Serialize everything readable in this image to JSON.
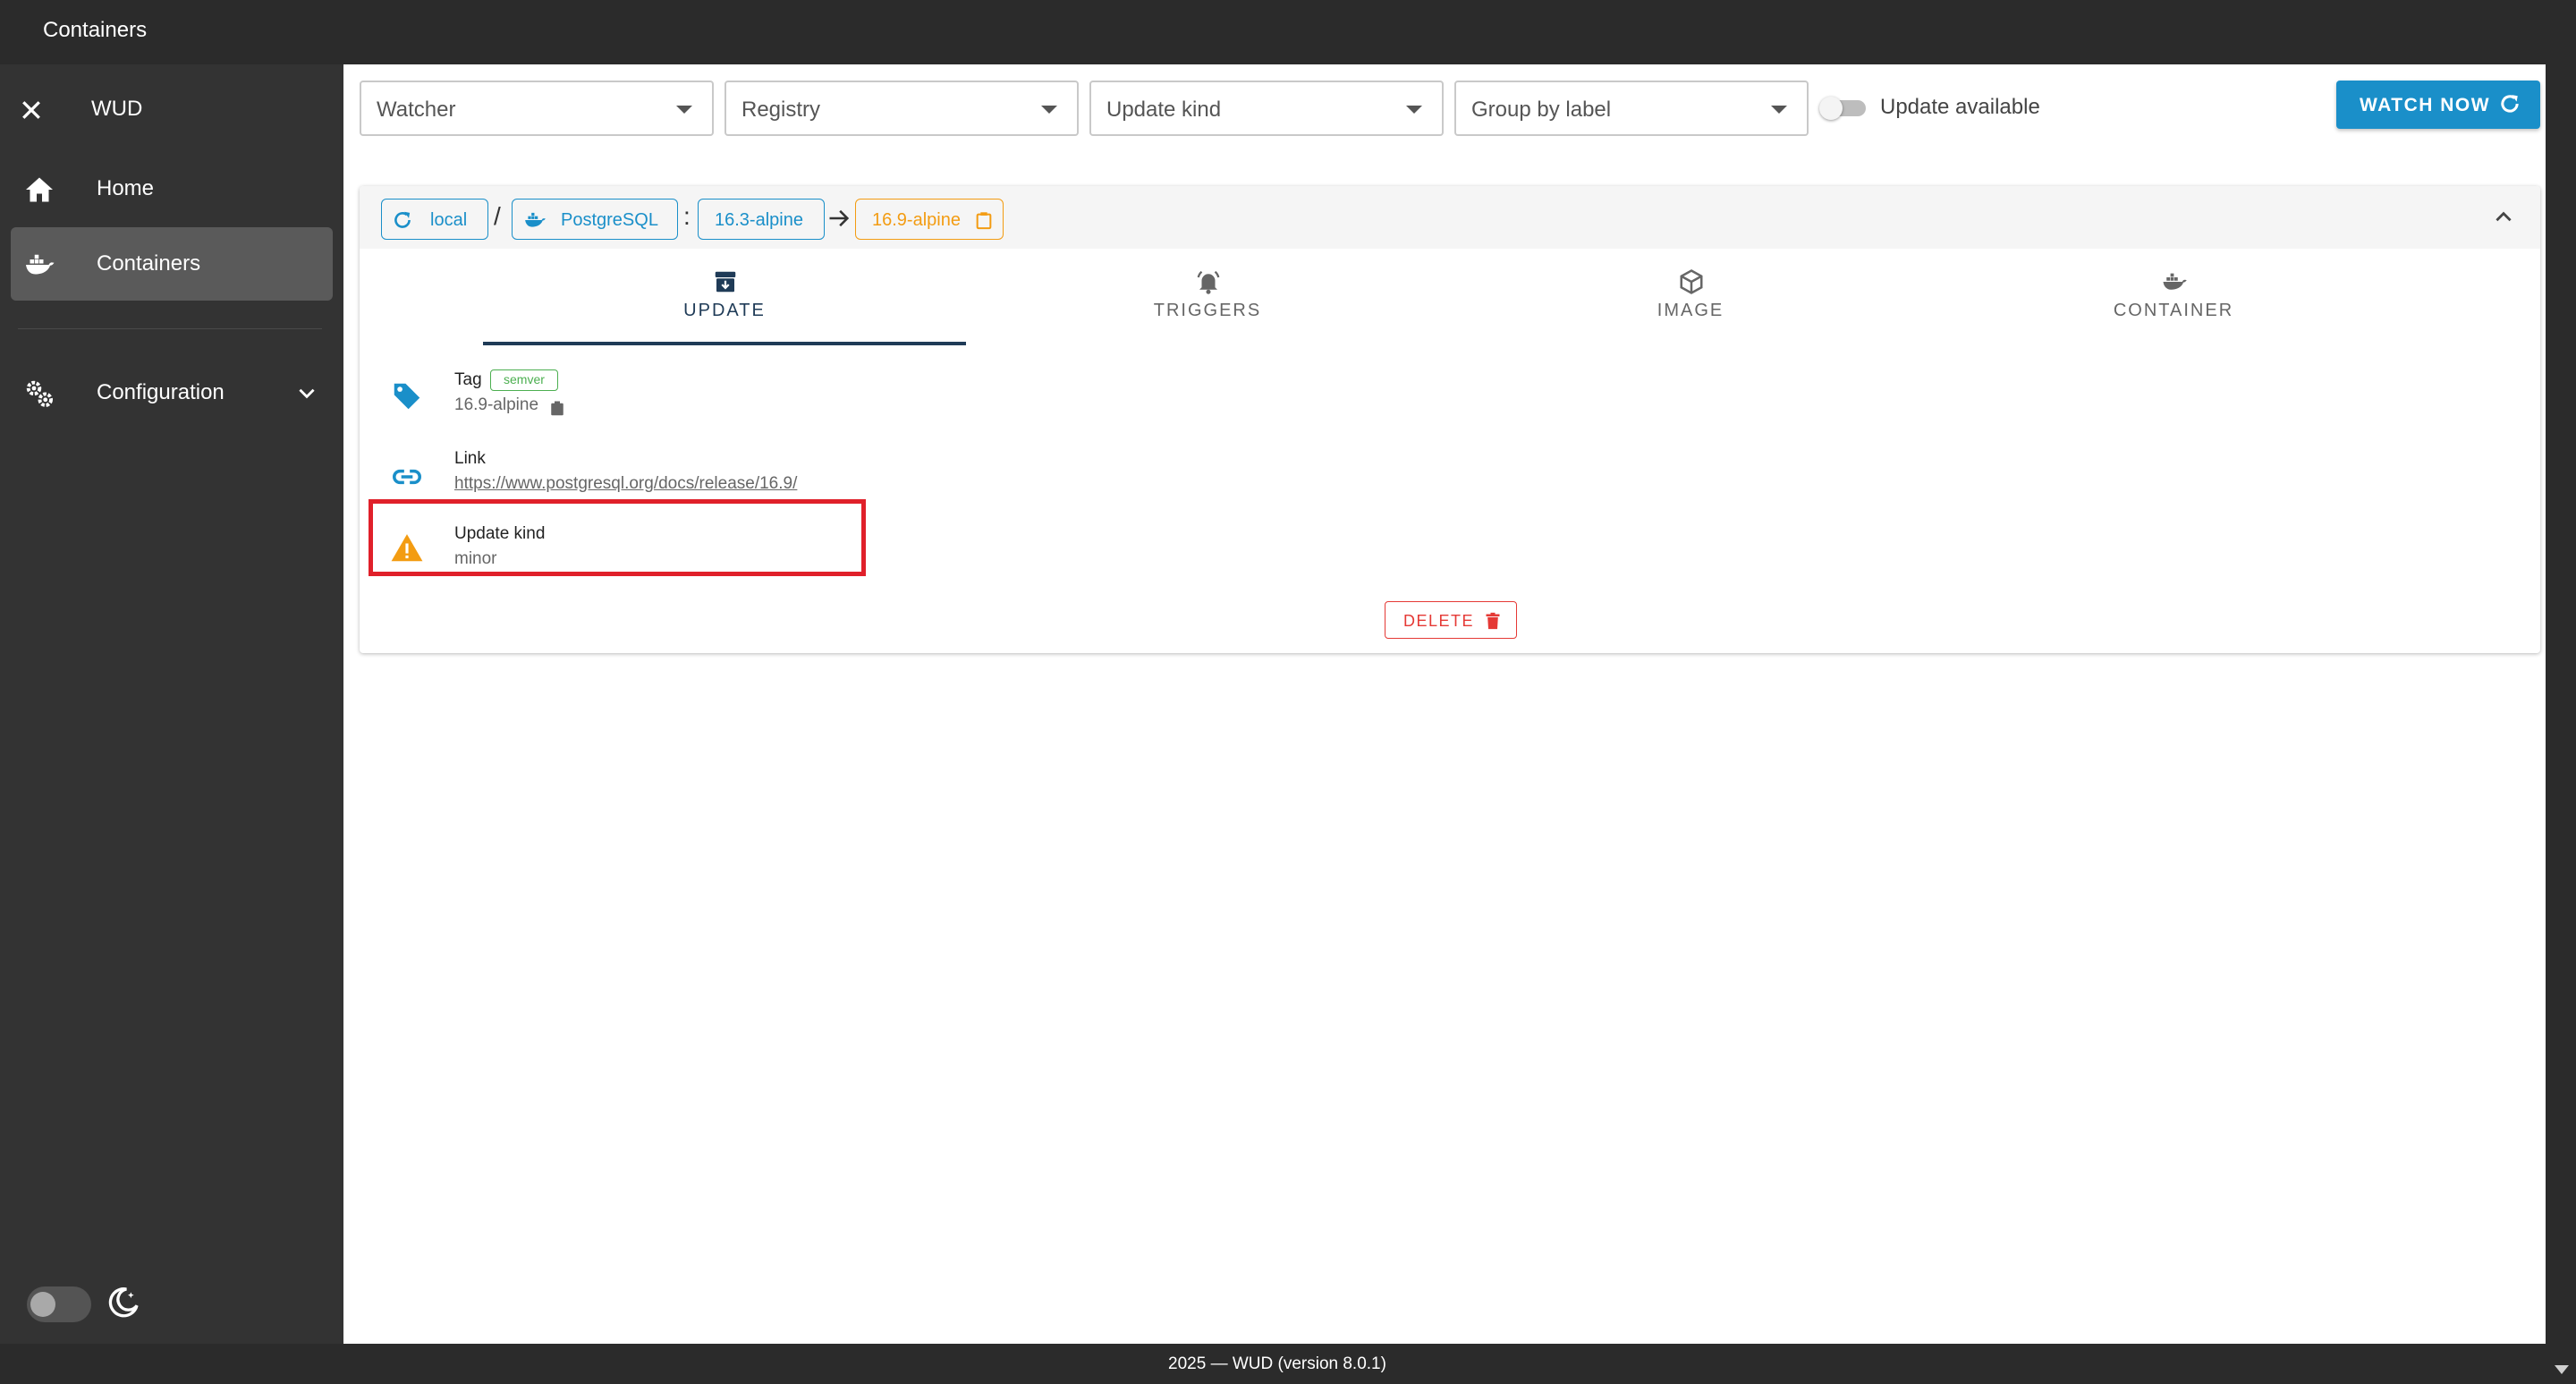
{
  "appbar": {
    "title": "Containers"
  },
  "sidebar": {
    "brand": "WUD",
    "items": [
      {
        "label": "Home",
        "icon": "home-icon"
      },
      {
        "label": "Containers",
        "icon": "docker-whale-icon",
        "active": true
      },
      {
        "label": "Configuration",
        "icon": "gears-icon",
        "expandable": true
      }
    ],
    "theme_toggle": {
      "dark_mode": false,
      "icon": "moon-icon"
    }
  },
  "filters": {
    "watcher_placeholder": "Watcher",
    "registry_placeholder": "Registry",
    "update_kind_placeholder": "Update kind",
    "group_by_placeholder": "Group by label",
    "update_available_label": "Update available",
    "update_available_on": false,
    "watch_now_label": "WATCH NOW"
  },
  "container": {
    "watcher": "local",
    "separator_slash": "/",
    "name": "PostgreSQL",
    "separator_colon": ":",
    "current_tag": "16.3-alpine",
    "new_tag": "16.9-alpine",
    "tabs": [
      {
        "label": "UPDATE",
        "icon": "archive-down-icon",
        "active": true
      },
      {
        "label": "TRIGGERS",
        "icon": "bell-ring-icon"
      },
      {
        "label": "IMAGE",
        "icon": "package-icon"
      },
      {
        "label": "CONTAINER",
        "icon": "docker-whale-icon"
      }
    ],
    "update": {
      "tag_label": "Tag",
      "tag_badge": "semver",
      "tag_value": "16.9-alpine",
      "link_label": "Link",
      "link_value": "https://www.postgresql.org/docs/release/16.9/",
      "kind_label": "Update kind",
      "kind_value": "minor"
    },
    "delete_label": "DELETE"
  },
  "footer": {
    "text": "2025 — WUD (version 8.0.1)"
  },
  "colors": {
    "primary": "#1a8fc9",
    "accent_orange": "#f39c12",
    "danger": "#e53935",
    "success": "#4caf50",
    "sidebar_bg": "#333333",
    "appbar_bg": "#2b2b2b",
    "active_tab": "#1f3b57",
    "highlight_box": "#e0202a"
  }
}
